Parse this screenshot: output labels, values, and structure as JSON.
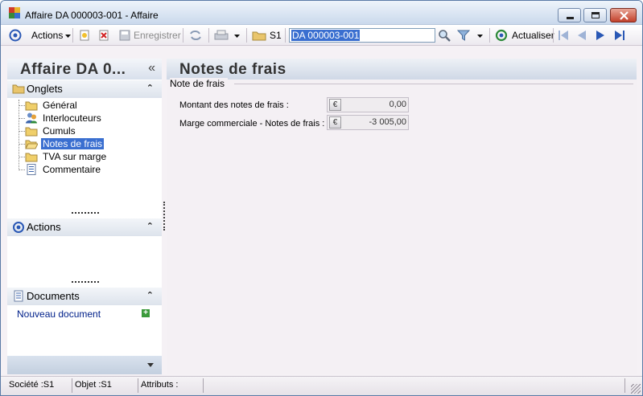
{
  "window": {
    "title": "Affaire DA 000003-001 -  Affaire"
  },
  "toolbar": {
    "actions_label": "Actions",
    "save_label": "Enregistrer",
    "society_label": "S1",
    "search_value": "DA 000003-001",
    "refresh_label": "Actualiser"
  },
  "left_panel": {
    "title": "Affaire DA 0...",
    "collapse_glyph": "«",
    "sections": {
      "tabs": {
        "label": "Onglets",
        "items": [
          {
            "label": "Général",
            "icon": "folder-icon"
          },
          {
            "label": "Interlocuteurs",
            "icon": "people-icon"
          },
          {
            "label": "Cumuls",
            "icon": "folder-icon"
          },
          {
            "label": "Notes de frais",
            "icon": "folder-open-icon",
            "selected": true
          },
          {
            "label": "TVA sur marge",
            "icon": "folder-icon"
          },
          {
            "label": "Commentaire",
            "icon": "document-icon"
          }
        ]
      },
      "actions": {
        "label": "Actions"
      },
      "documents": {
        "label": "Documents",
        "new_document": "Nouveau document"
      }
    }
  },
  "main": {
    "title": "Notes de frais",
    "group_label": "Note de frais",
    "fields": [
      {
        "label": "Montant des notes de frais :",
        "value": "0,00",
        "currency": "€"
      },
      {
        "label": "Marge commerciale - Notes de frais  :",
        "value": "-3 005,00",
        "currency": "€"
      }
    ]
  },
  "statusbar": {
    "society": "Société :S1",
    "object": "Objet :S1",
    "attributes": "Attributs :"
  },
  "colors": {
    "selection": "#3a6fd0",
    "header_gradient_top": "#eef1f6",
    "header_gradient_bottom": "#cfd8e6",
    "link": "#00208a"
  }
}
